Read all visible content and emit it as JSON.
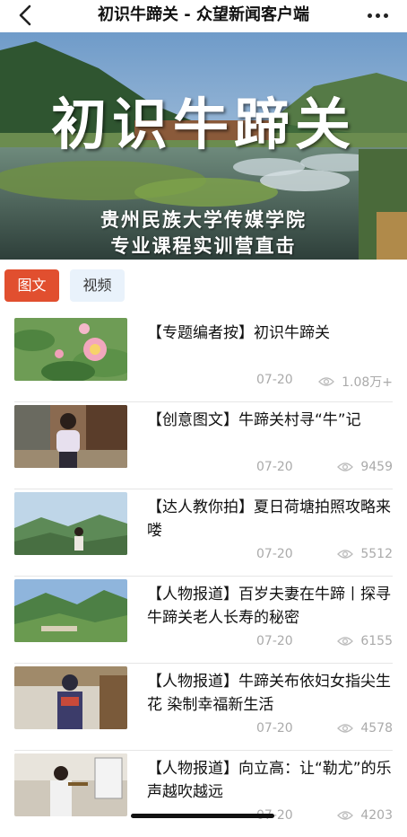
{
  "header": {
    "title": "初识牛蹄关 - 众望新闻客户端"
  },
  "banner": {
    "title": "初识牛蹄关",
    "subtitle_line1": "贵州民族大学传媒学院",
    "subtitle_line2": "专业课程实训营直击"
  },
  "tabs": [
    {
      "label": "图文",
      "active": true
    },
    {
      "label": "视频",
      "active": false
    }
  ],
  "articles": [
    {
      "title": "【专题编者按】初识牛蹄关",
      "date": "07-20",
      "views": "1.08万+",
      "thumb": "lotus"
    },
    {
      "title": "【创意图文】牛蹄关村寻“牛”记",
      "date": "07-20",
      "views": "9459",
      "thumb": "girl-village"
    },
    {
      "title": "【达人教你拍】夏日荷塘拍照攻略来喽",
      "date": "07-20",
      "views": "5512",
      "thumb": "girl-hills"
    },
    {
      "title": "【人物报道】百岁夫妻在牛蹄丨探寻牛蹄关老人长寿的秘密",
      "date": "07-20",
      "views": "6155",
      "thumb": "valley"
    },
    {
      "title": "【人物报道】牛蹄关布依妇女指尖生花 染制幸福新生活",
      "date": "07-20",
      "views": "4578",
      "thumb": "woman-costume"
    },
    {
      "title": "【人物报道】向立高：让“勒尤”的乐声越吹越远",
      "date": "07-20",
      "views": "4203",
      "thumb": "musician"
    }
  ],
  "colors": {
    "accent": "#e14f2f",
    "tab_inactive_bg": "#e9f2fb",
    "meta_text": "#aaaaaa"
  },
  "icons": {
    "back": "chevron-left-icon",
    "more": "more-dots-icon",
    "views": "eye-icon"
  }
}
